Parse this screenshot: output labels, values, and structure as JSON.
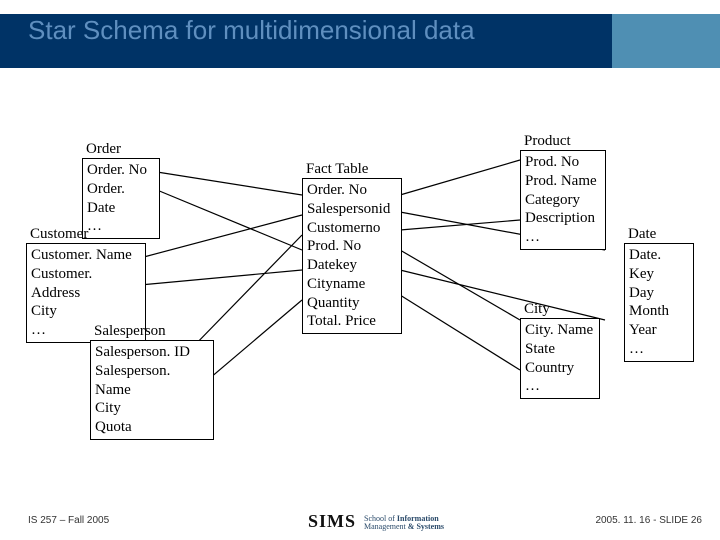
{
  "title": "Star Schema for multidimensional data",
  "tables": {
    "order": {
      "label": "Order",
      "rows": [
        "Order. No",
        "Order. Date",
        "…"
      ]
    },
    "customer": {
      "label": "Customer",
      "rows": [
        "Customer. Name",
        "Customer. Address",
        "City",
        "…"
      ]
    },
    "salesperson": {
      "label": "Salesperson",
      "rows": [
        "Salesperson. ID",
        "Salesperson. Name",
        "City",
        "Quota"
      ]
    },
    "fact": {
      "label": "Fact Table",
      "rows": [
        "Order. No",
        "Salespersonid",
        "Customerno",
        "Prod. No",
        "Datekey",
        "Cityname",
        "Quantity",
        "Total. Price"
      ]
    },
    "product": {
      "label": "Product",
      "rows": [
        "Prod. No",
        "Prod. Name",
        "Category",
        "Description",
        "…"
      ]
    },
    "city": {
      "label": "City",
      "rows": [
        "City. Name",
        "State",
        "Country",
        "…"
      ]
    },
    "date": {
      "label": "Date",
      "rows": [
        "Date. Key",
        "Day",
        "Month",
        "Year",
        "…"
      ]
    }
  },
  "footer": {
    "left": "IS 257 – Fall 2005",
    "right": "2005. 11. 16 - SLIDE 26",
    "sims": "SIMS",
    "sims_sub1": "School of",
    "sims_sub2": "Information",
    "sims_sub3": "Management",
    "sims_sub4": "& Systems"
  }
}
